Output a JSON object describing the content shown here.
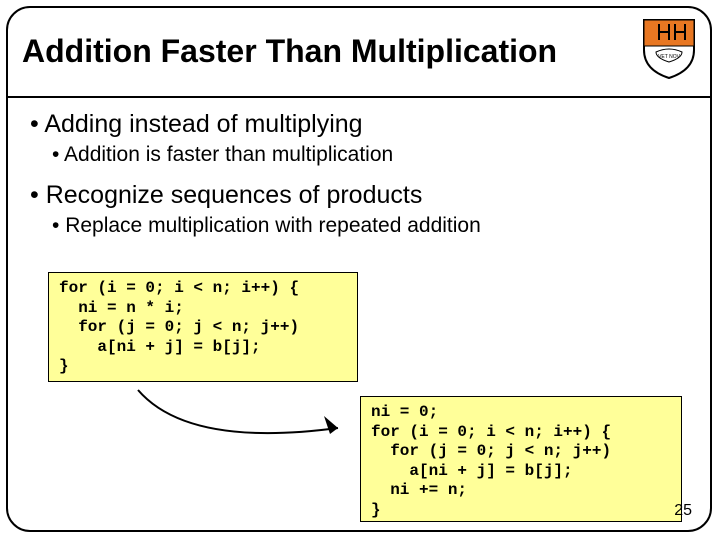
{
  "title": "Addition Faster Than Multiplication",
  "bullets": {
    "l1a": "Adding instead of multiplying",
    "l2a": "Addition is faster than multiplication",
    "l1b": "Recognize sequences of products",
    "l2b": "Replace multiplication with repeated addition"
  },
  "code1": "for (i = 0; i < n; i++) {\n  ni = n * i;\n  for (j = 0; j < n; j++)\n    a[ni + j] = b[j];\n}",
  "code2": "ni = 0;\nfor (i = 0; i < n; i++) {\n  for (j = 0; j < n; j++)\n    a[ni + j] = b[j];\n  ni += n;\n}",
  "pagenum": "25"
}
